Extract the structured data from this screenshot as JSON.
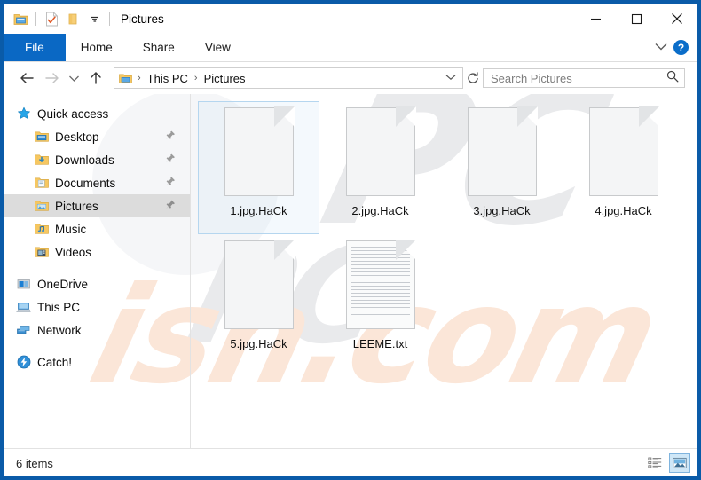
{
  "window": {
    "title": "Pictures",
    "quick_access": [
      {
        "name": "explorer-properties-icon",
        "label": "Properties"
      },
      {
        "name": "new-folder-icon",
        "label": "New folder"
      },
      {
        "name": "customize-qat-chevron-icon",
        "label": "Customize Quick Access Toolbar"
      }
    ],
    "caption": {
      "minimize": "—",
      "maximize": "❑",
      "close": "✕"
    }
  },
  "ribbon": {
    "tabs": [
      {
        "label": "File",
        "active": true
      },
      {
        "label": "Home",
        "active": false
      },
      {
        "label": "Share",
        "active": false
      },
      {
        "label": "View",
        "active": false
      }
    ],
    "collapse_label": "∨",
    "help_label": "?"
  },
  "address": {
    "back": "←",
    "forward": "→",
    "recent": "∨",
    "up": "↑",
    "crumbs": [
      "This PC",
      "Pictures"
    ],
    "separator": "›",
    "dropdown": "∨",
    "refresh": "↻"
  },
  "search": {
    "placeholder": "Search Pictures",
    "value": "Search Pictures",
    "icon": "search-icon"
  },
  "sidebar": {
    "groups": [
      {
        "header": {
          "label": "Quick access",
          "icon": "star-icon"
        },
        "items": [
          {
            "label": "Desktop",
            "icon": "desktop-folder-icon",
            "pinned": true,
            "selected": false
          },
          {
            "label": "Downloads",
            "icon": "downloads-folder-icon",
            "pinned": true,
            "selected": false
          },
          {
            "label": "Documents",
            "icon": "documents-folder-icon",
            "pinned": true,
            "selected": false
          },
          {
            "label": "Pictures",
            "icon": "pictures-folder-icon",
            "pinned": true,
            "selected": true
          },
          {
            "label": "Music",
            "icon": "music-folder-icon",
            "pinned": false,
            "selected": false
          },
          {
            "label": "Videos",
            "icon": "videos-folder-icon",
            "pinned": false,
            "selected": false
          }
        ]
      },
      {
        "items": [
          {
            "label": "OneDrive",
            "icon": "onedrive-icon",
            "pinned": false,
            "selected": false
          },
          {
            "label": "This PC",
            "icon": "this-pc-icon",
            "pinned": false,
            "selected": false
          },
          {
            "label": "Network",
            "icon": "network-icon",
            "pinned": false,
            "selected": false
          },
          {
            "label": "Catch!",
            "icon": "catch-lightning-icon",
            "pinned": false,
            "selected": false
          }
        ]
      }
    ],
    "pin_glyph": "\u0001"
  },
  "files": [
    {
      "name": "1.jpg.HaCk",
      "kind": "encrypted",
      "selected": true
    },
    {
      "name": "2.jpg.HaCk",
      "kind": "encrypted",
      "selected": false
    },
    {
      "name": "3.jpg.HaCk",
      "kind": "encrypted",
      "selected": false
    },
    {
      "name": "4.jpg.HaCk",
      "kind": "encrypted",
      "selected": false
    },
    {
      "name": "5.jpg.HaCk",
      "kind": "encrypted",
      "selected": false
    },
    {
      "name": "LEEME.txt",
      "kind": "text",
      "selected": false
    }
  ],
  "status": {
    "item_count": "6 items",
    "views": [
      {
        "name": "details-view-button",
        "active": false
      },
      {
        "name": "large-icons-view-button",
        "active": true
      }
    ]
  },
  "watermark": {
    "orange_text": "ish.com",
    "gray_text": "PC",
    "color_orange": "#fbe6d8",
    "color_gray": "#e9eaec"
  },
  "colors": {
    "window_border": "#0a5ba8",
    "file_tab": "#0a68c4",
    "selection": "#dcdcdc",
    "file_selection_border": "#b5d6ef",
    "help_blue": "#0a6dc9"
  }
}
